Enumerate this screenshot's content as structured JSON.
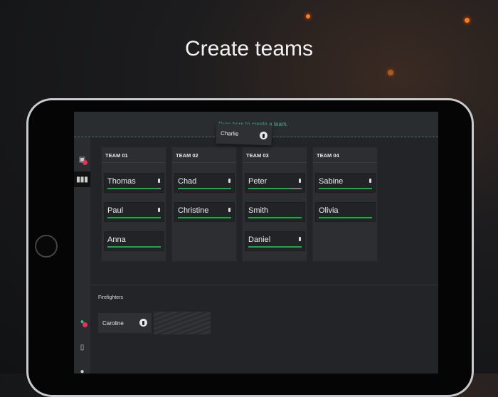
{
  "headline": "Create teams",
  "drop_zone": {
    "label": "Drop here to create a team."
  },
  "dragging": {
    "name": "Charlie"
  },
  "teams": [
    {
      "title": "TEAM 01",
      "members": [
        {
          "name": "Thomas",
          "progress": 95
        },
        {
          "name": "Paul",
          "progress": 100
        },
        {
          "name": "Anna",
          "progress": 100
        }
      ]
    },
    {
      "title": "TEAM 02",
      "members": [
        {
          "name": "Chad",
          "progress": 100
        },
        {
          "name": "Christine",
          "progress": 100
        }
      ]
    },
    {
      "title": "TEAM 03",
      "members": [
        {
          "name": "Peter",
          "progress": 80
        },
        {
          "name": "Smith",
          "progress": 100
        },
        {
          "name": "Daniel",
          "progress": 100
        }
      ]
    },
    {
      "title": "TEAM 04",
      "members": [
        {
          "name": "Sabine",
          "progress": 100
        },
        {
          "name": "Olivia",
          "progress": 100
        }
      ]
    }
  ],
  "pool": {
    "title": "Firefighters",
    "members": [
      {
        "name": "Caroline"
      }
    ]
  },
  "colors": {
    "accent": "#1fa84a",
    "badge": "#e8315a",
    "drop": "#4fae8c"
  }
}
